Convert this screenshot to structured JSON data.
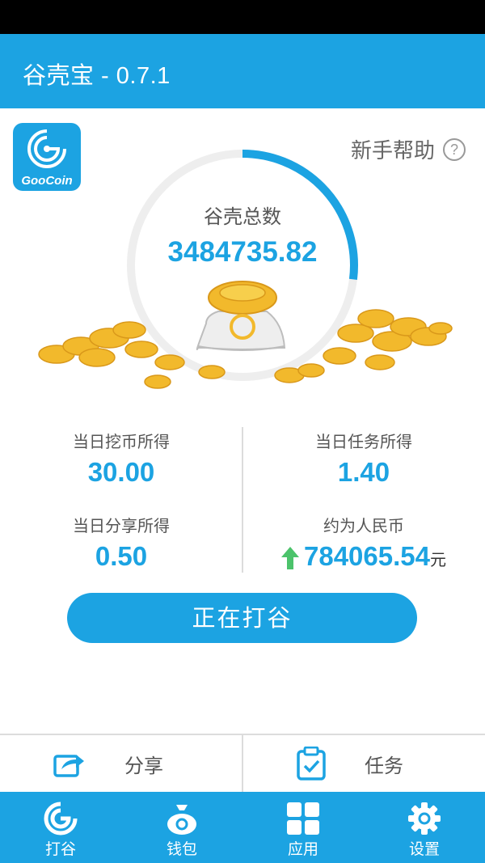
{
  "app": {
    "title": "谷壳宝 - 0.7.1"
  },
  "logo": {
    "text": "GooCoin"
  },
  "help": {
    "label": "新手帮助",
    "icon": "question-circle-icon",
    "glyph": "?"
  },
  "total": {
    "label": "谷壳总数",
    "value": "3484735.82",
    "progress_fraction": 0.27
  },
  "stats": {
    "mining_today": {
      "label": "当日挖币所得",
      "value": "30.00"
    },
    "task_today": {
      "label": "当日任务所得",
      "value": "1.40"
    },
    "share_today": {
      "label": "当日分享所得",
      "value": "0.50"
    },
    "rmb": {
      "label": "约为人民币",
      "value": "784065.54",
      "unit": "元",
      "trend_icon": "up-arrow-icon"
    }
  },
  "main_button": {
    "label": "正在打谷"
  },
  "actions": [
    {
      "label": "分享",
      "icon": "share-icon"
    },
    {
      "label": "任务",
      "icon": "clipboard-check-icon"
    }
  ],
  "tabs": [
    {
      "label": "打谷",
      "icon": "goocoin-icon"
    },
    {
      "label": "钱包",
      "icon": "money-bag-icon"
    },
    {
      "label": "应用",
      "icon": "apps-grid-icon"
    },
    {
      "label": "设置",
      "icon": "gear-icon"
    }
  ],
  "colors": {
    "primary": "#1ca3e2",
    "ring_track": "#eeeeee",
    "up_arrow": "#4cc36b",
    "gold": "#f2b92c"
  }
}
